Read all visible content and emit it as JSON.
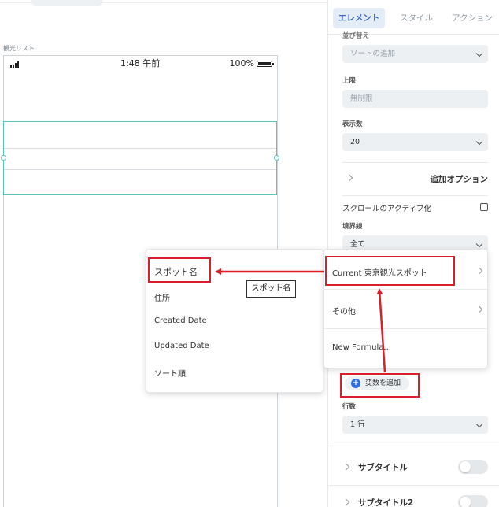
{
  "canvas": {
    "screen_label": "観光リスト",
    "status_time": "1:48 午前",
    "battery_percent": "100%"
  },
  "panel": {
    "tabs": [
      {
        "label": "エレメント",
        "active": true
      },
      {
        "label": "スタイル",
        "active": false
      },
      {
        "label": "アクション",
        "active": false
      }
    ],
    "sort_label": "並び替え",
    "sort_placeholder": "ソートの追加",
    "limit_label": "上限",
    "limit_placeholder": "無制限",
    "count_label": "表示数",
    "count_value": "20",
    "extra_options": "追加オプション",
    "scroll_active": "スクロールのアクティブ化",
    "border_label": "境界線",
    "border_value": "全て",
    "add_variable": "変数を追加",
    "rows_label": "行数",
    "rows_value": "1 行",
    "subtitle": "サブタイトル",
    "subtitle2": "サブタイトル2"
  },
  "source_menu": {
    "items": [
      "Current 東京観光スポット",
      "その他",
      "New Formula..."
    ]
  },
  "field_menu": {
    "items": [
      "スポット名",
      "住所",
      "Created Date",
      "Updated Date",
      "ソート順"
    ]
  },
  "tooltip": "スポット名",
  "colors": {
    "accent": "#3b6bc4",
    "selection": "#5cc4bd",
    "annotation": "#d9202a",
    "add_button": "#2f6fe0"
  }
}
